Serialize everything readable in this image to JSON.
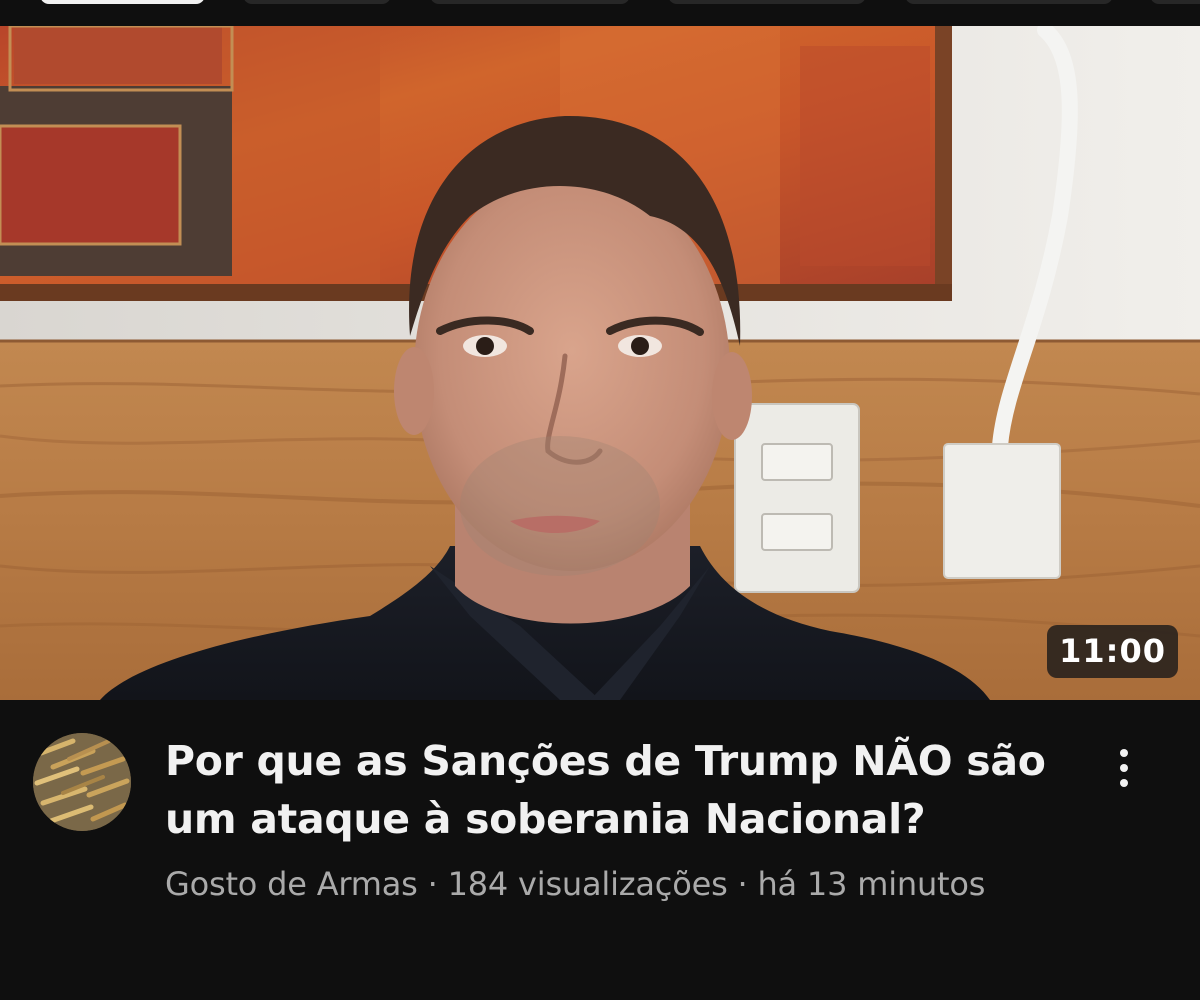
{
  "video": {
    "duration": "11:00",
    "title": "Por que as Sanções de Trump NÃO são um ataque à soberania Nacional?",
    "channel": "Gosto de Armas",
    "separator": " · ",
    "views": "184 visualizações",
    "age": "há 13 minutos"
  },
  "icons": {
    "more": "more-vertical-icon",
    "avatar": "channel-avatar"
  },
  "colors": {
    "background": "#0f0f0f",
    "title": "#f1f1f1",
    "subtitle": "#aaaaaa",
    "duration_badge": "#26201c"
  }
}
